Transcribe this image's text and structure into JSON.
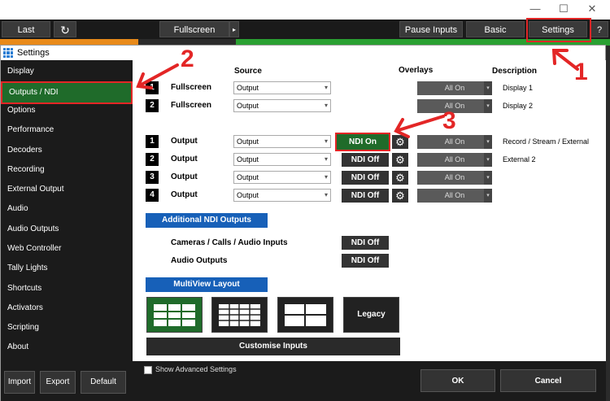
{
  "topbar": {
    "last": "Last",
    "fullscreen": "Fullscreen",
    "pause_inputs": "Pause Inputs",
    "basic": "Basic",
    "settings": "Settings",
    "help": "?"
  },
  "dialog": {
    "title": "Settings"
  },
  "sidebar": {
    "items": [
      "Display",
      "Outputs / NDI",
      "Options",
      "Performance",
      "Decoders",
      "Recording",
      "External Output",
      "Audio",
      "Audio Outputs",
      "Web Controller",
      "Tally Lights",
      "Shortcuts",
      "Activators",
      "Scripting",
      "About"
    ],
    "import": "Import",
    "export": "Export",
    "default": "Default"
  },
  "headers": {
    "source": "Source",
    "overlays": "Overlays",
    "description": "Description"
  },
  "display_rows": [
    {
      "num": "1",
      "name": "Fullscreen",
      "source": "Output",
      "overlay": "All On",
      "desc": "Display 1"
    },
    {
      "num": "2",
      "name": "Fullscreen",
      "source": "Output",
      "overlay": "All On",
      "desc": "Display 2"
    }
  ],
  "output_rows": [
    {
      "num": "1",
      "name": "Output",
      "source": "Output",
      "ndi": "NDI On",
      "overlay": "All On",
      "desc": "Record / Stream / External"
    },
    {
      "num": "2",
      "name": "Output",
      "source": "Output",
      "ndi": "NDI Off",
      "overlay": "All On",
      "desc": "External 2"
    },
    {
      "num": "3",
      "name": "Output",
      "source": "Output",
      "ndi": "NDI Off",
      "overlay": "All On",
      "desc": ""
    },
    {
      "num": "4",
      "name": "Output",
      "source": "Output",
      "ndi": "NDI Off",
      "overlay": "All On",
      "desc": ""
    }
  ],
  "additional": {
    "button": "Additional NDI Outputs",
    "cameras_label": "Cameras / Calls / Audio Inputs",
    "cameras_ndi": "NDI Off",
    "audio_label": "Audio Outputs",
    "audio_ndi": "NDI Off"
  },
  "multiview": {
    "button": "MultiView Layout",
    "legacy": "Legacy",
    "customise": "Customise Inputs"
  },
  "footer": {
    "show_advanced": "Show Advanced Settings",
    "ok": "OK",
    "cancel": "Cancel"
  },
  "annotations": {
    "one": "1",
    "two": "2",
    "three": "3"
  },
  "colors": {
    "accent_green": "#1f6b2a",
    "annotation_red": "#e32626",
    "button_blue": "#1760b8"
  }
}
